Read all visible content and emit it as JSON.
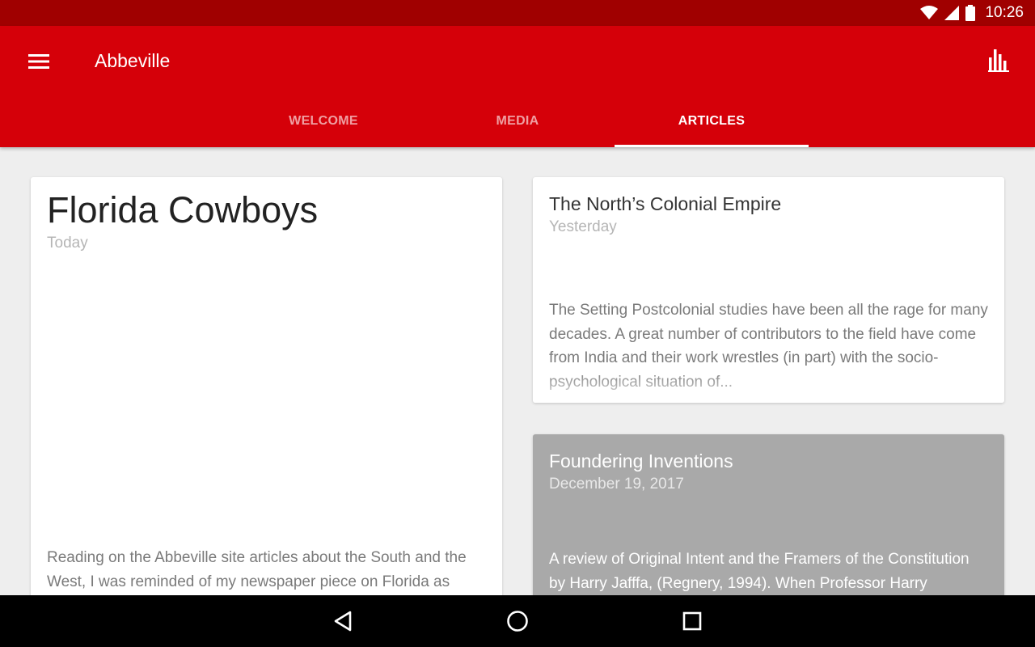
{
  "status_bar": {
    "time": "10:26",
    "icons": [
      "wifi-icon",
      "signal-icon",
      "battery-icon"
    ]
  },
  "app_bar": {
    "title": "Abbeville",
    "menu_icon": "hamburger-menu-icon",
    "action_icon": "bar-chart-icon",
    "color": "#d50009"
  },
  "tabs": [
    {
      "label": "WELCOME",
      "active": false
    },
    {
      "label": "MEDIA",
      "active": false
    },
    {
      "label": "ARTICLES",
      "active": true
    }
  ],
  "articles": [
    {
      "title": "Florida Cowboys",
      "date": "Today",
      "excerpt": "Reading on the Abbeville site articles about the South and the West, I was reminded of my newspaper piece on Florida as"
    },
    {
      "title": "The North’s Colonial Empire",
      "date": "Yesterday",
      "excerpt": "The Setting Postcolonial studies have been all the rage for many decades. A great number of contributors to the field have come from India and their work wrestles (in part) with the socio-psychological situation of..."
    },
    {
      "title": "Foundering Inventions",
      "date": "December 19, 2017",
      "excerpt": "A review of Original Intent and the Framers of the Constitution by Harry Jafffa, (Regnery, 1994). When Professor Harry"
    }
  ],
  "nav_bar": {
    "icons": [
      "back-icon",
      "home-icon",
      "recents-icon"
    ]
  }
}
